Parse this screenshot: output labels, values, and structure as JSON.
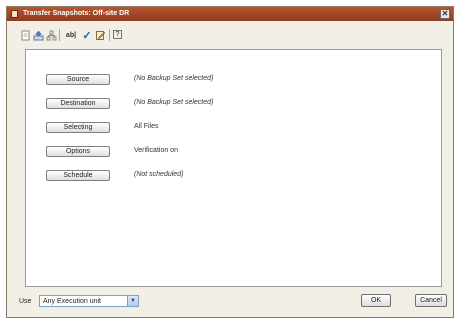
{
  "window": {
    "title": "Transfer Snapshots: Off-site DR",
    "close_glyph": "✕"
  },
  "toolbar": {
    "icons": [
      "document-icon",
      "upload-icon",
      "hierarchy-icon",
      "text-field-icon",
      "checkmark-icon",
      "script-icon",
      "help-icon"
    ],
    "text_field_glyph": "ab|",
    "check_glyph": "✓",
    "help_glyph": "?"
  },
  "rows": [
    {
      "button": "Source",
      "value": "(No Backup Set selected)"
    },
    {
      "button": "Destination",
      "value": "(No Backup Set selected)"
    },
    {
      "button": "Selecting",
      "value": "All Files"
    },
    {
      "button": "Options",
      "value": "Verification on"
    },
    {
      "button": "Schedule",
      "value": "(Not scheduled)"
    }
  ],
  "footer": {
    "use_label": "Use",
    "execution_unit": "Any Execution unit",
    "ok_label": "OK",
    "cancel_label": "Cancel"
  }
}
